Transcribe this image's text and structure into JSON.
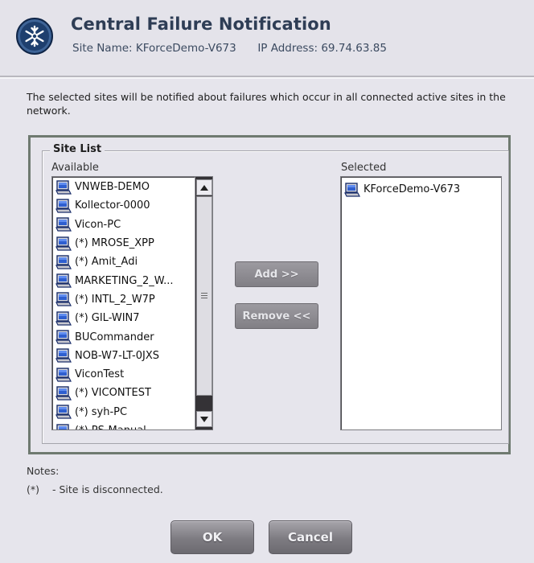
{
  "header": {
    "title": "Central Failure Notification",
    "site_name_label": "Site Name:",
    "site_name": "KForceDemo-V673",
    "ip_label": "IP Address:",
    "ip_address": "69.74.63.85",
    "logo_icon": "snowflake-logo-icon"
  },
  "description": "The selected sites will be notified about failures which occur in all connected active sites in the network.",
  "site_list": {
    "group_title": "Site List",
    "available_label": "Available",
    "selected_label": "Selected",
    "available_items": [
      "VNWEB-DEMO",
      "Kollector-0000",
      "Vicon-PC",
      "(*) MROSE_XPP",
      "(*) Amit_Adi",
      "MARKETING_2_W...",
      "(*) INTL_2_W7P",
      "(*) GIL-WIN7",
      "BUCommander",
      "NOB-W7-LT-0JXS",
      "ViconTest",
      "(*) VICONTEST",
      "(*) syh-PC",
      "(*) PS-Manual"
    ],
    "selected_items": [
      "KForceDemo-V673"
    ],
    "item_icon": "computer-icon"
  },
  "actions": {
    "add_label": "Add >>",
    "remove_label": "Remove <<"
  },
  "notes": {
    "title": "Notes:",
    "key": "(*)",
    "text": "- Site is disconnected."
  },
  "footer": {
    "ok_label": "OK",
    "cancel_label": "Cancel"
  },
  "colors": {
    "background": "#e6e5ec",
    "title": "#2e3d55",
    "button_gray": "#817f85",
    "scrollbar_track": "#343236"
  }
}
